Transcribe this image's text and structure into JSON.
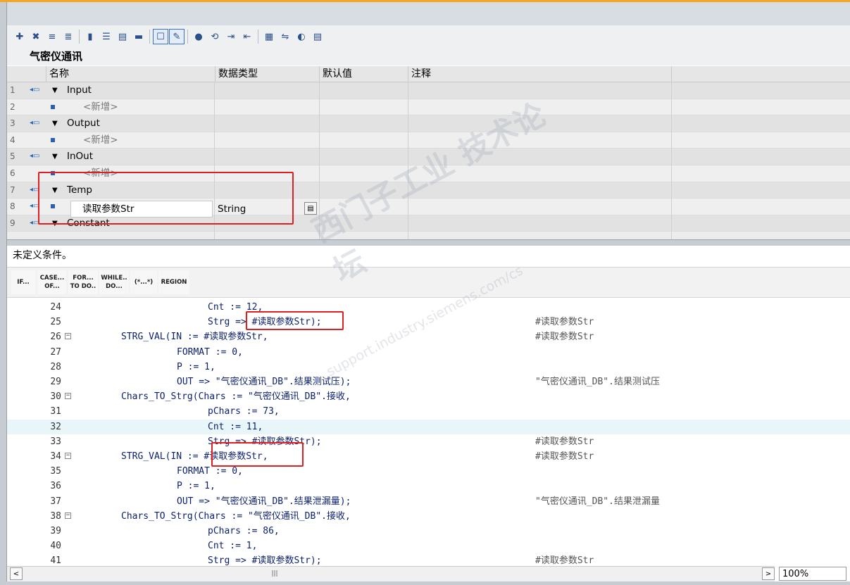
{
  "toolbar": {
    "icons": [
      "insert-network-icon",
      "delete-network-icon",
      "insert-row-icon",
      "append-row-icon",
      "monitor-icon",
      "absolute-operands-icon",
      "network-toggle-icon",
      "comments-icon",
      "display-format-icon",
      "favorites-icon",
      "breakpoint-icon",
      "go-to-next-error-icon",
      "indent-icon",
      "outdent-icon",
      "snippet-icon",
      "compare-icon",
      "watch-icon",
      "load-icon"
    ],
    "selected": [
      "display-format-icon",
      "favorites-icon"
    ]
  },
  "block": {
    "title": "气密仪通讯"
  },
  "iface": {
    "headers": {
      "name": "名称",
      "datatype": "数据类型",
      "default": "默认值",
      "comment": "注释"
    },
    "rows": [
      {
        "num": "1",
        "label": "Input",
        "kind": "section"
      },
      {
        "num": "2",
        "label": "<新增>",
        "kind": "add"
      },
      {
        "num": "3",
        "label": "Output",
        "kind": "section"
      },
      {
        "num": "4",
        "label": "<新增>",
        "kind": "add"
      },
      {
        "num": "5",
        "label": "InOut",
        "kind": "section"
      },
      {
        "num": "6",
        "label": "<新增>",
        "kind": "add"
      },
      {
        "num": "7",
        "label": "Temp",
        "kind": "section"
      },
      {
        "num": "8",
        "label": "读取参数Str",
        "kind": "var",
        "type": "String"
      },
      {
        "num": "9",
        "label": "Constant",
        "kind": "section"
      }
    ],
    "edit_name": "读取参数Str",
    "edit_type": "String"
  },
  "condition": {
    "text": "未定义条件。"
  },
  "instructions": [
    {
      "label1": "IF...",
      "label2": ""
    },
    {
      "label1": "CASE...",
      "label2": "OF..."
    },
    {
      "label1": "FOR...",
      "label2": "TO DO.."
    },
    {
      "label1": "WHILE..",
      "label2": "DO..."
    },
    {
      "label1": "(*...*)",
      "label2": ""
    },
    {
      "label1": "REGION",
      "label2": ""
    }
  ],
  "code": {
    "lines": [
      {
        "n": "24",
        "indent": 2,
        "text": "Cnt := 12,",
        "comment": "",
        "fold": false
      },
      {
        "n": "25",
        "indent": 2,
        "text": "Strg => #读取参数Str);",
        "comment": "#读取参数Str",
        "fold": false
      },
      {
        "n": "26",
        "indent": 0,
        "text": "STRG_VAL(IN := #读取参数Str,",
        "comment": "#读取参数Str",
        "fold": true
      },
      {
        "n": "27",
        "indent": 1,
        "text": "FORMAT := 0,",
        "comment": "",
        "fold": false
      },
      {
        "n": "28",
        "indent": 1,
        "text": "P := 1,",
        "comment": "",
        "fold": false
      },
      {
        "n": "29",
        "indent": 1,
        "text": "OUT => \"气密仪通讯_DB\".结果测试压);",
        "comment": "\"气密仪通讯_DB\".结果测试压",
        "fold": false
      },
      {
        "n": "30",
        "indent": 0,
        "text": "Chars_TO_Strg(Chars := \"气密仪通讯_DB\".接收,",
        "comment": "",
        "fold": true
      },
      {
        "n": "31",
        "indent": 2,
        "text": "pChars := 73,",
        "comment": "",
        "fold": false
      },
      {
        "n": "32",
        "indent": 2,
        "text": "Cnt := 11,",
        "comment": "",
        "fold": false
      },
      {
        "n": "33",
        "indent": 2,
        "text": "Strg => #读取参数Str);",
        "comment": "#读取参数Str",
        "fold": false
      },
      {
        "n": "34",
        "indent": 0,
        "text": "STRG_VAL(IN := #读取参数Str,",
        "comment": "#读取参数Str",
        "fold": true
      },
      {
        "n": "35",
        "indent": 1,
        "text": "FORMAT := 0,",
        "comment": "",
        "fold": false
      },
      {
        "n": "36",
        "indent": 1,
        "text": "P := 1,",
        "comment": "",
        "fold": false
      },
      {
        "n": "37",
        "indent": 1,
        "text": "OUT => \"气密仪通讯_DB\".结果泄漏量);",
        "comment": "\"气密仪通讯_DB\".结果泄漏量",
        "fold": false
      },
      {
        "n": "38",
        "indent": 0,
        "text": "Chars_TO_Strg(Chars := \"气密仪通讯_DB\".接收,",
        "comment": "",
        "fold": true
      },
      {
        "n": "39",
        "indent": 2,
        "text": "pChars := 86,",
        "comment": "",
        "fold": false
      },
      {
        "n": "40",
        "indent": 2,
        "text": "Cnt := 1,",
        "comment": "",
        "fold": false
      },
      {
        "n": "41",
        "indent": 2,
        "text": "Strg => #读取参数Str);",
        "comment": "#读取参数Str",
        "fold": false
      }
    ],
    "current_line": "32"
  },
  "statusbar": {
    "zoom": "100%"
  },
  "watermark": {
    "line1": "西门子工业 技术论坛",
    "line2": "support.industry.siemens.com/cs"
  }
}
